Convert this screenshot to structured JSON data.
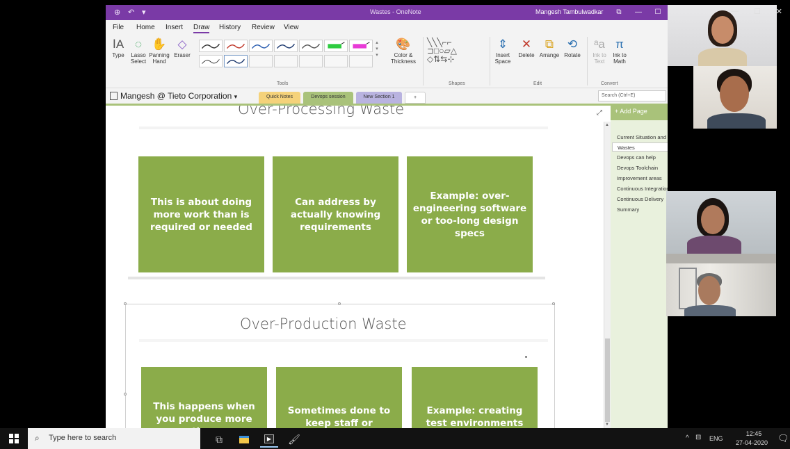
{
  "window": {
    "title": "Wastes - OneNote",
    "user": "Mangesh Tambulwadkar",
    "quick_access": [
      "←",
      "↶",
      "▾"
    ],
    "controls": [
      "⧉",
      "—",
      "☐"
    ]
  },
  "menu": {
    "items": [
      "File",
      "Home",
      "Insert",
      "Draw",
      "History",
      "Review",
      "View"
    ],
    "active": "Draw"
  },
  "ribbon": {
    "type_label": "Type",
    "lasso_label_1": "Lasso",
    "lasso_label_2": "Select",
    "panning_label_1": "Panning",
    "panning_label_2": "Hand",
    "eraser_label": "Eraser",
    "tools_group": "Tools",
    "color_label_1": "Color &",
    "color_label_2": "Thickness",
    "shapes_group": "Shapes",
    "insert_space_1": "Insert",
    "insert_space_2": "Space",
    "delete_label": "Delete",
    "arrange_label": "Arrange",
    "rotate_label": "Rotate",
    "edit_group": "Edit",
    "ink_text_1": "Ink to",
    "ink_text_2": "Text",
    "ink_math_1": "Ink to",
    "ink_math_2": "Math",
    "convert_group": "Convert"
  },
  "nav": {
    "notebook": "Mangesh @ Tieto Corporation",
    "sections": [
      {
        "label": "Quick Notes",
        "color": "#f5d27a"
      },
      {
        "label": "Devops session",
        "color": "#a9c27a"
      },
      {
        "label": "New Section 1",
        "color": "#b9b3e0"
      },
      {
        "label": "+",
        "color": "#ffffff"
      }
    ],
    "search_placeholder": "Search (Ctrl+E)"
  },
  "slides": {
    "slide1": {
      "title": "Over-Processing Waste",
      "boxes": [
        "This is about doing more work than is required or needed",
        "Can address by actually knowing requirements",
        "Example: over-engineering software or too-long design specs"
      ]
    },
    "slide2": {
      "title": "Over-Production Waste",
      "boxes": [
        "This happens when you produce more than",
        "Sometimes done to keep staff or machines busy",
        "Example: creating test environments for each team"
      ]
    }
  },
  "pages": {
    "add_label": "+ Add Page",
    "items": [
      "Current Situation and Pain",
      "Wastes",
      "Devops can help",
      "Devops Toolchain",
      "Improvement areas",
      "Continuous Integration",
      "Continuous Delivery",
      "Summary"
    ],
    "selected": "Wastes"
  },
  "outer_window_controls": [
    "—",
    "☐",
    "✕"
  ],
  "taskbar": {
    "search_placeholder": "Type here to search",
    "language": "ENG",
    "time": "12:45",
    "date": "27-04-2020"
  },
  "colors": {
    "onenote_purple": "#7a3aa6",
    "slide_green": "#8bac4a",
    "pane_green": "#a9c27a"
  }
}
